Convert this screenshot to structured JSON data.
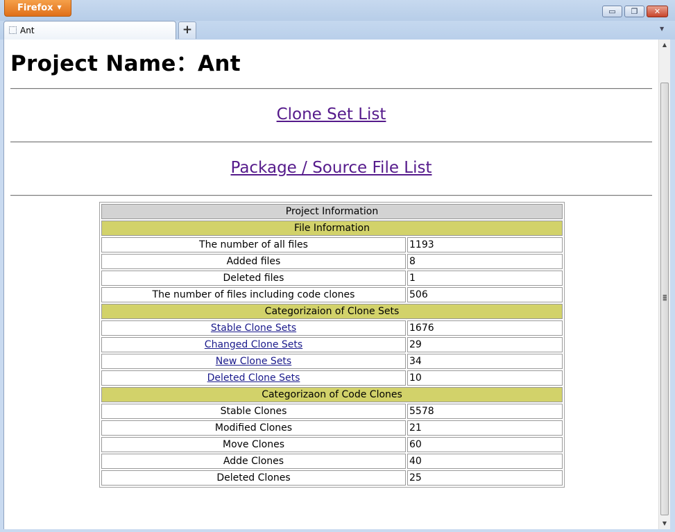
{
  "browser": {
    "menu_button": "Firefox",
    "tab_title": "Ant",
    "new_tab": "+",
    "controls": {
      "minimize": "▭",
      "restore": "❐",
      "close": "✕"
    }
  },
  "page": {
    "title": "Project Name：Ant",
    "link_clone_sets": "Clone Set List",
    "link_package_files": "Package / Source File List"
  },
  "table": {
    "header": "Project Information",
    "file_section": "File Information",
    "file_rows": [
      {
        "label": "The number of all files",
        "value": "1193"
      },
      {
        "label": "Added files",
        "value": "8"
      },
      {
        "label": "Deleted files",
        "value": "1"
      },
      {
        "label": "The number of files including code clones",
        "value": "506"
      }
    ],
    "cloneset_section": "Categorizaion of Clone Sets",
    "cloneset_rows": [
      {
        "label": "Stable Clone Sets",
        "value": "1676"
      },
      {
        "label": "Changed Clone Sets",
        "value": "29"
      },
      {
        "label": "New Clone Sets",
        "value": "34"
      },
      {
        "label": "Deleted Clone Sets",
        "value": "10"
      }
    ],
    "codeclone_section": "Categorizaon of Code Clones",
    "codeclone_rows": [
      {
        "label": "Stable Clones",
        "value": "5578"
      },
      {
        "label": "Modified Clones",
        "value": "21"
      },
      {
        "label": "Move Clones",
        "value": "60"
      },
      {
        "label": "Adde Clones",
        "value": "40"
      },
      {
        "label": "Deleted Clones",
        "value": "25"
      }
    ]
  },
  "colors": {
    "section_header": "#d2d26a",
    "table_header": "#d3d3d3",
    "visited_link": "#551a8b",
    "link": "#1a1a8b",
    "firefox_button": "#e0701a"
  }
}
